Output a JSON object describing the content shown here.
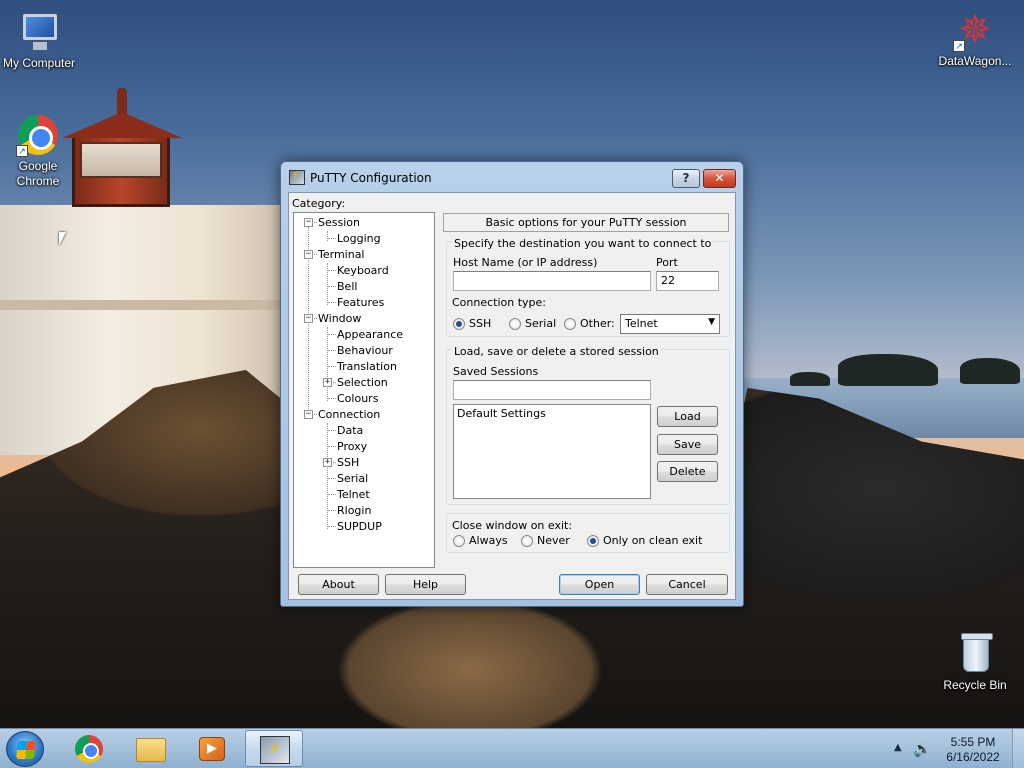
{
  "desktop": {
    "icons": {
      "my_computer": "My Computer",
      "chrome_line1": "Google",
      "chrome_line2": "Chrome",
      "datawagon": "DataWagon...",
      "recycle_bin": "Recycle Bin"
    }
  },
  "window": {
    "title": "PuTTY Configuration",
    "help_glyph": "?",
    "close_glyph": "✕",
    "category_label": "Category:",
    "tree": [
      {
        "label": "Session",
        "level": 0,
        "expander": "−"
      },
      {
        "label": "Logging",
        "level": 1
      },
      {
        "label": "Terminal",
        "level": 0,
        "expander": "−"
      },
      {
        "label": "Keyboard",
        "level": 1
      },
      {
        "label": "Bell",
        "level": 1
      },
      {
        "label": "Features",
        "level": 1
      },
      {
        "label": "Window",
        "level": 0,
        "expander": "−"
      },
      {
        "label": "Appearance",
        "level": 1
      },
      {
        "label": "Behaviour",
        "level": 1
      },
      {
        "label": "Translation",
        "level": 1
      },
      {
        "label": "Selection",
        "level": 1,
        "expander": "+"
      },
      {
        "label": "Colours",
        "level": 1
      },
      {
        "label": "Connection",
        "level": 0,
        "expander": "−"
      },
      {
        "label": "Data",
        "level": 1
      },
      {
        "label": "Proxy",
        "level": 1
      },
      {
        "label": "SSH",
        "level": 1,
        "expander": "+"
      },
      {
        "label": "Serial",
        "level": 1
      },
      {
        "label": "Telnet",
        "level": 1
      },
      {
        "label": "Rlogin",
        "level": 1
      },
      {
        "label": "SUPDUP",
        "level": 1
      }
    ],
    "panel_header": "Basic options for your PuTTY session",
    "destination": {
      "legend": "Specify the destination you want to connect to",
      "host_label": "Host Name (or IP address)",
      "host_value": "",
      "port_label": "Port",
      "port_value": "22",
      "conn_type_label": "Connection type:",
      "options": [
        "SSH",
        "Serial",
        "Other:"
      ],
      "selected": "SSH",
      "other_select_value": "Telnet"
    },
    "sessions": {
      "legend": "Load, save or delete a stored session",
      "saved_label": "Saved Sessions",
      "saved_value": "",
      "list": [
        "Default Settings"
      ],
      "load": "Load",
      "save": "Save",
      "delete": "Delete"
    },
    "close_on_exit": {
      "legend": "Close window on exit:",
      "options": [
        "Always",
        "Never",
        "Only on clean exit"
      ],
      "selected": "Only on clean exit"
    },
    "buttons": {
      "about": "About",
      "help": "Help",
      "open": "Open",
      "cancel": "Cancel"
    }
  },
  "taskbar": {
    "time": "5:55 PM",
    "date": "6/16/2022",
    "tray_arrow": "▲",
    "speaker_glyph": "🔊"
  }
}
